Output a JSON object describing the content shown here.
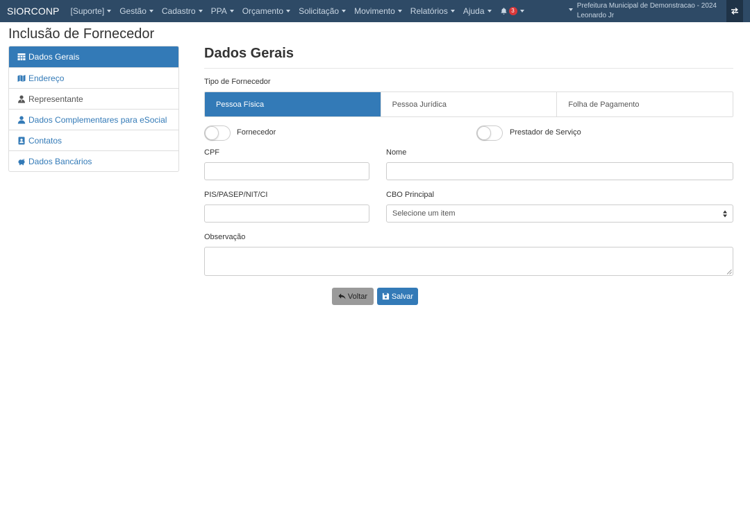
{
  "navbar": {
    "brand": "SIORCONP",
    "menu": [
      {
        "id": "suporte",
        "label": "[Suporte]"
      },
      {
        "id": "gestao",
        "label": "Gestão"
      },
      {
        "id": "cadastro",
        "label": "Cadastro"
      },
      {
        "id": "ppa",
        "label": "PPA"
      },
      {
        "id": "orcamento",
        "label": "Orçamento"
      },
      {
        "id": "solicitacao",
        "label": "Solicitação"
      },
      {
        "id": "movimento",
        "label": "Movimento"
      },
      {
        "id": "relatorios",
        "label": "Relatórios"
      },
      {
        "id": "ajuda",
        "label": "Ajuda"
      }
    ],
    "notifications_count": "3",
    "entity": "Prefeitura Municipal de Demonstracao - 2024",
    "user": "Leonardo Jr",
    "icons": {
      "notifications": "bell-icon",
      "swap": "swap-arrows-icon"
    }
  },
  "page": {
    "title": "Inclusão de Fornecedor"
  },
  "sidebar": {
    "items": [
      {
        "label": "Dados Gerais",
        "icon": "table-icon",
        "active": true
      },
      {
        "label": "Endereço",
        "icon": "map-icon"
      },
      {
        "label": "Representante",
        "icon": "user-tie-icon"
      },
      {
        "label": "Dados Complementares para eSocial",
        "icon": "user-icon"
      },
      {
        "label": "Contatos",
        "icon": "address-book-icon"
      },
      {
        "label": "Dados Bancários",
        "icon": "piggy-bank-icon"
      }
    ]
  },
  "form": {
    "section_title": "Dados Gerais",
    "tipo_label": "Tipo de Fornecedor",
    "tipo_options": [
      "Pessoa Física",
      "Pessoa Jurídica",
      "Folha de Pagamento"
    ],
    "tipo_selected": "Pessoa Física",
    "fornecedor_label": "Fornecedor",
    "fornecedor_on": false,
    "prestador_label": "Prestador de Serviço",
    "prestador_on": false,
    "cpf_label": "CPF",
    "cpf_value": "",
    "nome_label": "Nome",
    "nome_value": "",
    "pis_label": "PIS/PASEP/NIT/CI",
    "pis_value": "",
    "cbo_label": "CBO Principal",
    "cbo_selected": "Selecione um item",
    "obs_label": "Observação",
    "obs_value": ""
  },
  "buttons": {
    "back": "Voltar",
    "save": "Salvar"
  },
  "colors": {
    "navbar": "#2e4a66",
    "primary": "#337ab7",
    "back_button": "#9a9a9a",
    "badge": "#d9383a"
  }
}
